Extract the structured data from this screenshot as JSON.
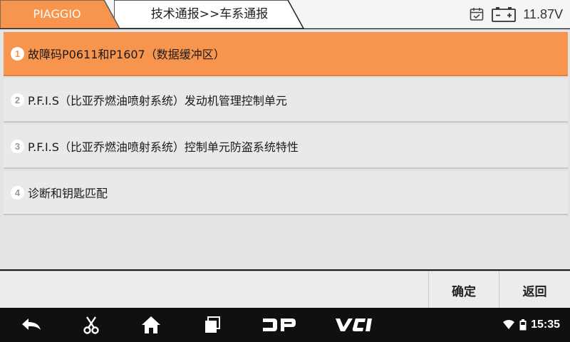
{
  "header": {
    "brand": "PIAGGIO",
    "breadcrumb": "技术通报>>车系通报",
    "voltage": "11.87V",
    "accent_color": "#f7944e"
  },
  "menu": {
    "items": [
      {
        "number": "1",
        "label": "故障码P0611和P1607（数据缓冲区）",
        "selected": true
      },
      {
        "number": "2",
        "label": "P.F.I.S（比亚乔燃油喷射系统）发动机管理控制单元",
        "selected": false
      },
      {
        "number": "3",
        "label": "P.F.I.S（比亚乔燃油喷射系统）控制单元防盗系统特性",
        "selected": false
      },
      {
        "number": "4",
        "label": "诊断和钥匙匹配",
        "selected": false
      }
    ]
  },
  "actions": {
    "confirm_label": "确定",
    "back_label": "返回"
  },
  "navbar": {
    "icons": [
      "back-icon",
      "scissors-icon",
      "home-icon",
      "recent-apps-icon",
      "dp-icon",
      "vci-icon"
    ],
    "dp_label": "DP",
    "vci_label": "VCI",
    "time": "15:35"
  }
}
